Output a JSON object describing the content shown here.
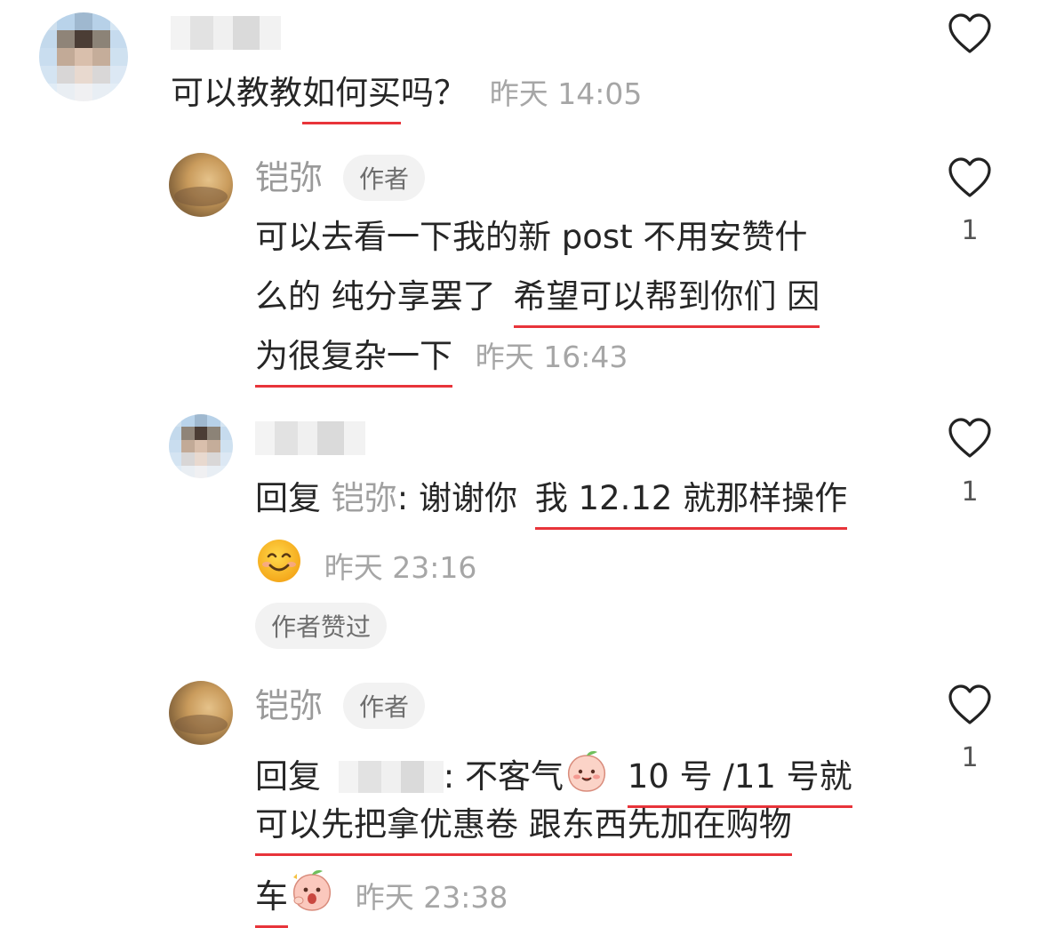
{
  "comments": [
    {
      "text_plain": "可以教教",
      "text_underlined": "如何买",
      "text_end": "吗？",
      "time": "昨天 14:05",
      "like_count": ""
    },
    {
      "author": "铠弥",
      "author_tag": "作者",
      "line1": "可以去看一下我的新 post 不用安赞什",
      "line2_plain": "么的 纯分享罢了",
      "line2_underlined": "希望可以帮到你们 因",
      "line3_underlined": "为很复杂一下",
      "time": "昨天 16:43",
      "like_count": "1"
    },
    {
      "reply_prefix": "回复",
      "reply_to": "铠弥",
      "text_plain": ": 谢谢你",
      "text_underlined": "我 12.12 就那样操作",
      "emoji": "smiling-face-emoji",
      "time": "昨天 23:16",
      "like_count": "1",
      "liked_tag": "作者赞过"
    },
    {
      "author": "铠弥",
      "author_tag": "作者",
      "reply_prefix": "回复",
      "line1_plain": ": 不客气",
      "emoji1": "peach-smile-emoji",
      "line1_underlined": "10 号 /11 号就",
      "line2_underlined": "可以先把拿优惠卷 跟东西先加在购物",
      "line3_underlined": "车",
      "emoji2": "peach-surprised-emoji",
      "time": "昨天 23:38",
      "like_count": "1"
    }
  ],
  "icons": {
    "like": "heart-outline-icon"
  },
  "colors": {
    "underline": "#e8343a",
    "meta": "#a6a6a6",
    "tag_bg": "#f2f2f2"
  }
}
